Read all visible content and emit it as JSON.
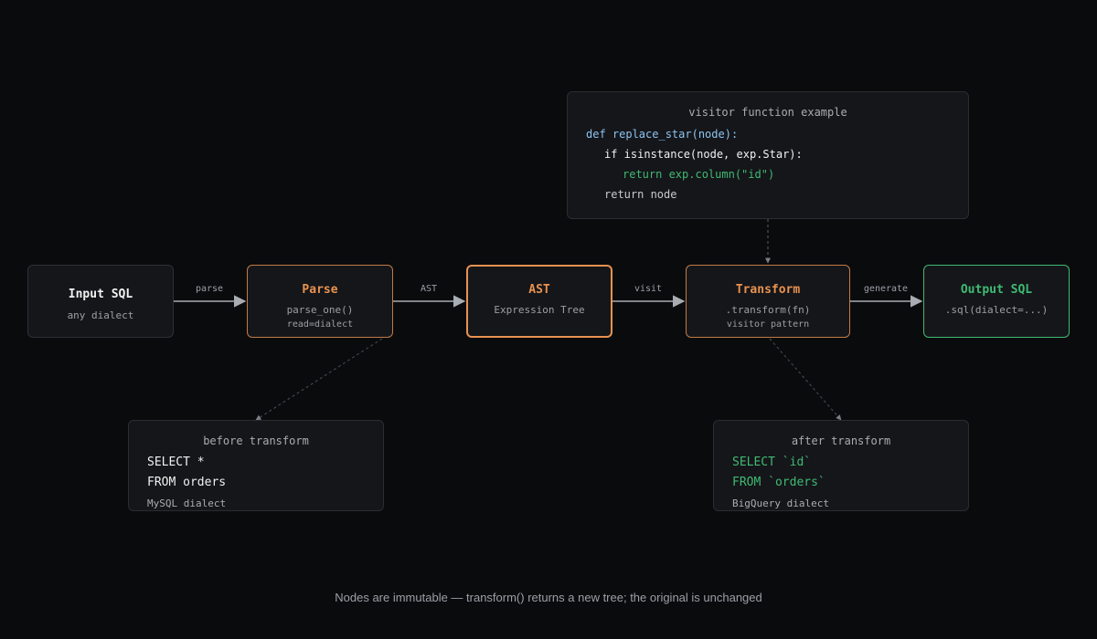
{
  "nodes": {
    "input": {
      "title": "Input SQL",
      "sub": "any dialect"
    },
    "parse": {
      "title": "Parse",
      "sub": "parse_one()",
      "sub2": "read=dialect"
    },
    "ast": {
      "title": "AST",
      "sub": "Expression Tree"
    },
    "transform": {
      "title": "Transform",
      "sub": ".transform(fn)",
      "sub2": "visitor pattern"
    },
    "output": {
      "title": "Output SQL",
      "sub": ".sql(dialect=...)"
    }
  },
  "edges": {
    "parse": "parse",
    "ast": "AST",
    "visit": "visit",
    "generate": "generate"
  },
  "visitor": {
    "title": "visitor function example",
    "lines": [
      "def replace_star(node):",
      "if isinstance(node, exp.Star):",
      "return exp.column(\"id\")",
      "return node"
    ]
  },
  "before": {
    "title": "before transform",
    "lines": [
      "SELECT *",
      "FROM orders"
    ],
    "dialect": "MySQL dialect"
  },
  "after": {
    "title": "after transform",
    "lines": [
      "SELECT `id`",
      "FROM `orders`"
    ],
    "dialect": "BigQuery dialect"
  },
  "footer": "Nodes are immutable — transform() returns a new tree; the original is unchanged",
  "colors": {
    "background": "#0a0b0d",
    "box_fill": "#15161a",
    "neutral_border": "#2e3035",
    "accent_orange": "#e8924f",
    "accent_orange_dim": "#c47a45",
    "accent_green": "#3fba73",
    "code_blue": "#8cc4f0",
    "code_green": "#3fba73",
    "text_white": "#f1f1f1",
    "text_muted": "#9aa0a6"
  }
}
